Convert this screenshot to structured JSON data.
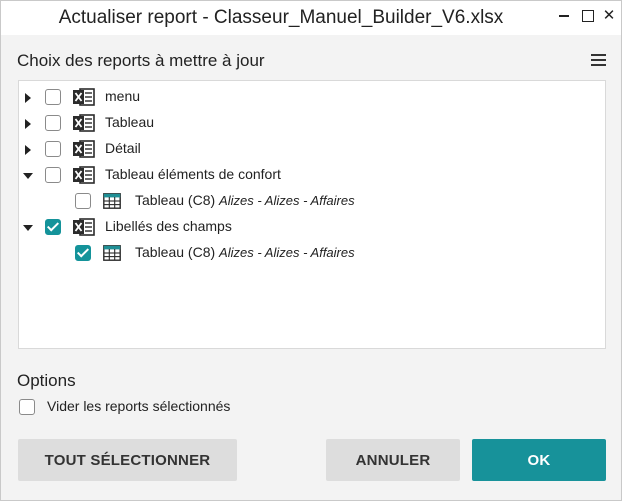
{
  "window": {
    "title": "Actualiser report - Classeur_Manuel_Builder_V6.xlsx"
  },
  "reports": {
    "heading": "Choix des reports à mettre à jour",
    "items": [
      {
        "label": "menu",
        "expanded": false,
        "checked": false,
        "icon": "excel-icon"
      },
      {
        "label": "Tableau",
        "expanded": false,
        "checked": false,
        "icon": "excel-icon"
      },
      {
        "label": "Détail",
        "expanded": false,
        "checked": false,
        "icon": "excel-icon"
      },
      {
        "label": "Tableau éléments de confort",
        "expanded": true,
        "checked": false,
        "icon": "excel-icon",
        "children": [
          {
            "label": "Tableau (C8)",
            "sub": "Alizes - Alizes - Affaires",
            "checked": false,
            "icon": "table-icon"
          }
        ]
      },
      {
        "label": "Libellés des champs",
        "expanded": true,
        "checked": true,
        "icon": "excel-icon",
        "children": [
          {
            "label": "Tableau (C8)",
            "sub": "Alizes - Alizes - Affaires",
            "checked": true,
            "icon": "table-icon"
          }
        ]
      }
    ]
  },
  "options": {
    "heading": "Options",
    "clear_label": "Vider les reports sélectionnés",
    "clear_checked": false
  },
  "buttons": {
    "select_all": "TOUT SÉLECTIONNER",
    "cancel": "ANNULER",
    "ok": "OK"
  },
  "colors": {
    "accent": "#17929a",
    "excel_icon": "#2b2b2b"
  }
}
